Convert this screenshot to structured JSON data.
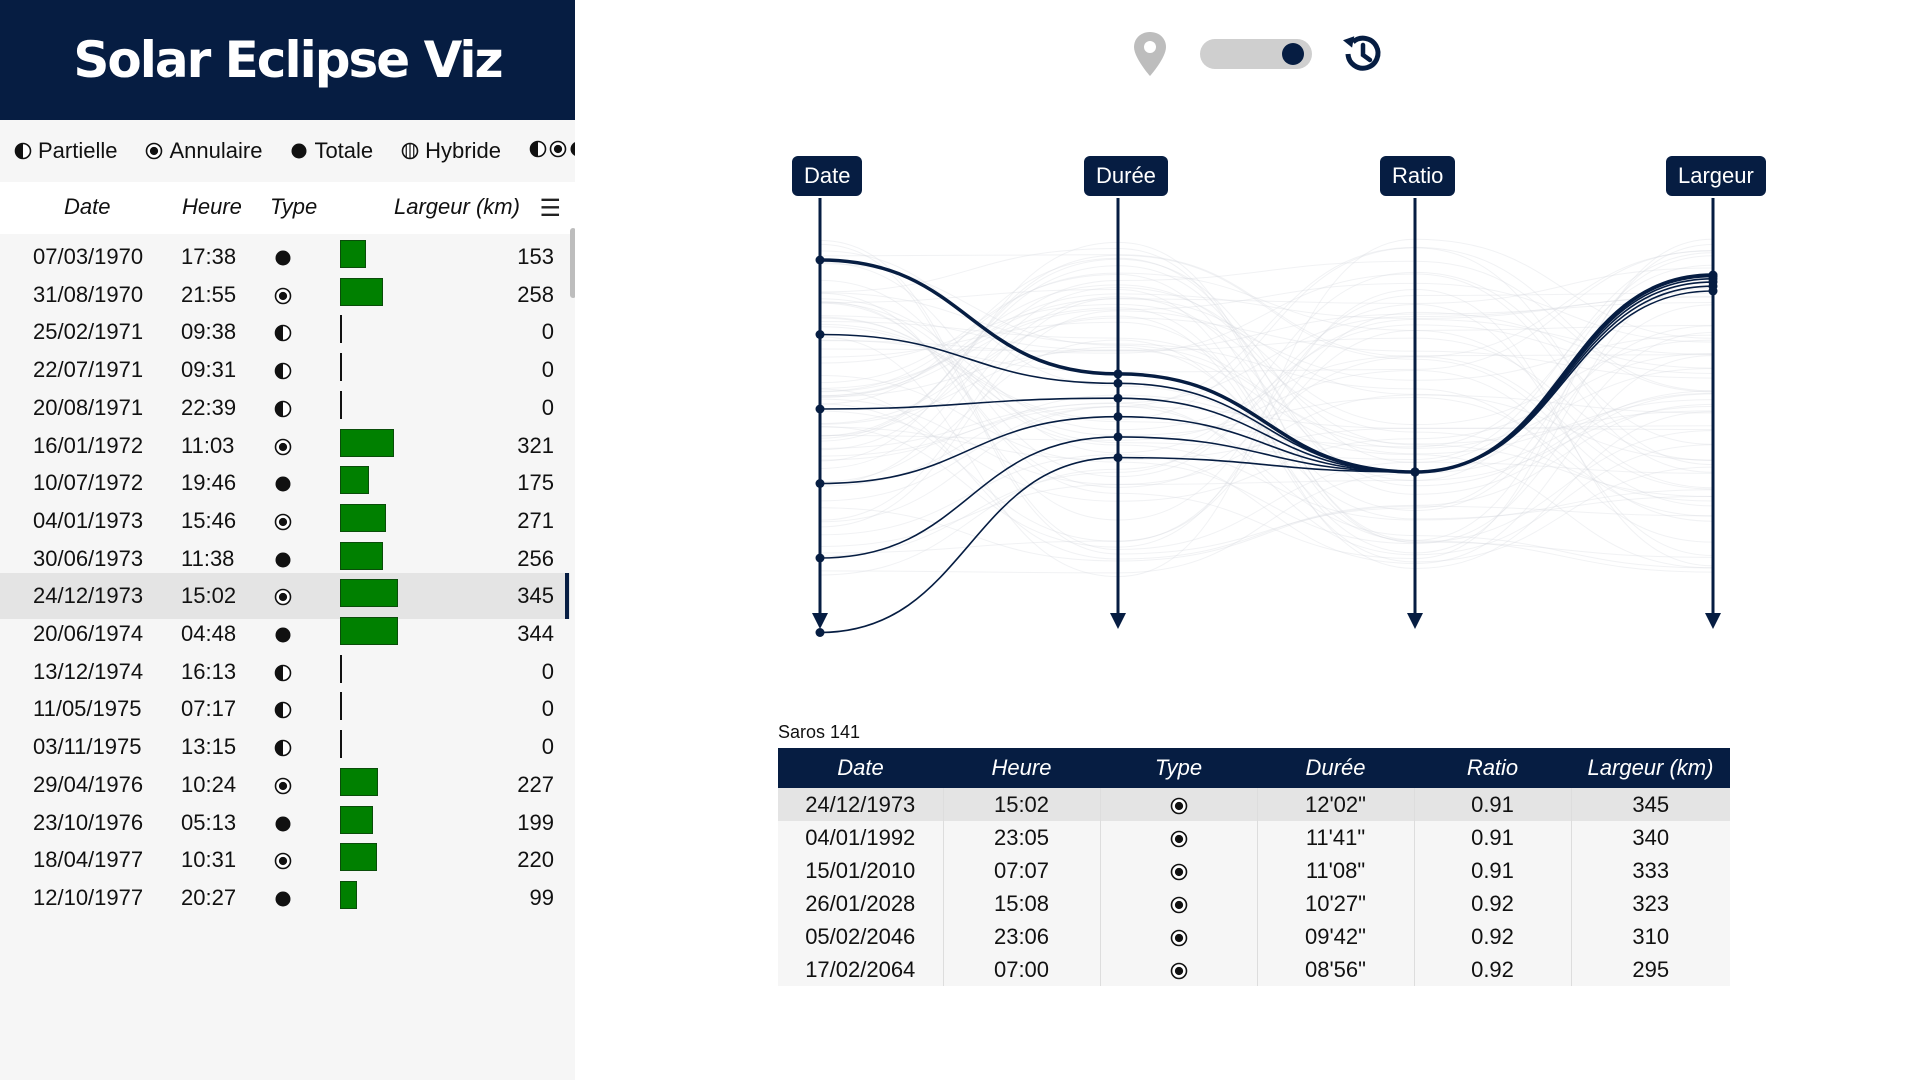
{
  "app": {
    "title": "Solar Eclipse Viz"
  },
  "legend": [
    {
      "label": "Partielle",
      "icon": "partial-eclipse-icon"
    },
    {
      "label": "Annulaire",
      "icon": "annular-eclipse-icon"
    },
    {
      "label": "Totale",
      "icon": "total-eclipse-icon"
    },
    {
      "label": "Hybride",
      "icon": "hybrid-eclipse-icon"
    }
  ],
  "list_header": {
    "date": "Date",
    "time": "Heure",
    "type": "Type",
    "width": "Largeur (km)"
  },
  "list_max_width_km": 345,
  "eclipses": [
    {
      "date": "07/03/1970",
      "time": "17:38",
      "type": "total",
      "width": 153
    },
    {
      "date": "31/08/1970",
      "time": "21:55",
      "type": "annular",
      "width": 258
    },
    {
      "date": "25/02/1971",
      "time": "09:38",
      "type": "partial",
      "width": 0
    },
    {
      "date": "22/07/1971",
      "time": "09:31",
      "type": "partial",
      "width": 0
    },
    {
      "date": "20/08/1971",
      "time": "22:39",
      "type": "partial",
      "width": 0
    },
    {
      "date": "16/01/1972",
      "time": "11:03",
      "type": "annular",
      "width": 321
    },
    {
      "date": "10/07/1972",
      "time": "19:46",
      "type": "total",
      "width": 175
    },
    {
      "date": "04/01/1973",
      "time": "15:46",
      "type": "annular",
      "width": 271
    },
    {
      "date": "30/06/1973",
      "time": "11:38",
      "type": "total",
      "width": 256
    },
    {
      "date": "24/12/1973",
      "time": "15:02",
      "type": "annular",
      "width": 345,
      "selected": true
    },
    {
      "date": "20/06/1974",
      "time": "04:48",
      "type": "total",
      "width": 344
    },
    {
      "date": "13/12/1974",
      "time": "16:13",
      "type": "partial",
      "width": 0
    },
    {
      "date": "11/05/1975",
      "time": "07:17",
      "type": "partial",
      "width": 0
    },
    {
      "date": "03/11/1975",
      "time": "13:15",
      "type": "partial",
      "width": 0
    },
    {
      "date": "29/04/1976",
      "time": "10:24",
      "type": "annular",
      "width": 227
    },
    {
      "date": "23/10/1976",
      "time": "05:13",
      "type": "total",
      "width": 199
    },
    {
      "date": "18/04/1977",
      "time": "10:31",
      "type": "annular",
      "width": 220
    },
    {
      "date": "12/10/1977",
      "time": "20:27",
      "type": "total",
      "width": 99
    }
  ],
  "controls": {
    "toggle_on": true
  },
  "axes": [
    "Date",
    "Durée",
    "Ratio",
    "Largeur"
  ],
  "saros": {
    "label": "Saros 141",
    "columns": [
      "Date",
      "Heure",
      "Type",
      "Durée",
      "Ratio",
      "Largeur (km)"
    ],
    "rows": [
      {
        "date": "24/12/1973",
        "time": "15:02",
        "type": "annular",
        "duration": "12'02\"",
        "ratio": "0.91",
        "width": "345",
        "selected": true
      },
      {
        "date": "04/01/1992",
        "time": "23:05",
        "type": "annular",
        "duration": "11'41\"",
        "ratio": "0.91",
        "width": "340"
      },
      {
        "date": "15/01/2010",
        "time": "07:07",
        "type": "annular",
        "duration": "11'08\"",
        "ratio": "0.91",
        "width": "333"
      },
      {
        "date": "26/01/2028",
        "time": "15:08",
        "type": "annular",
        "duration": "10'27\"",
        "ratio": "0.92",
        "width": "323"
      },
      {
        "date": "05/02/2046",
        "time": "23:06",
        "type": "annular",
        "duration": "09'42\"",
        "ratio": "0.92",
        "width": "310"
      },
      {
        "date": "17/02/2064",
        "time": "07:00",
        "type": "annular",
        "duration": "08'56\"",
        "ratio": "0.92",
        "width": "295"
      }
    ]
  },
  "colors": {
    "navy": "#061d42",
    "bar_green": "#008000",
    "panel_bg": "#f6f6f6",
    "selected_bg": "#e4e4e4"
  }
}
